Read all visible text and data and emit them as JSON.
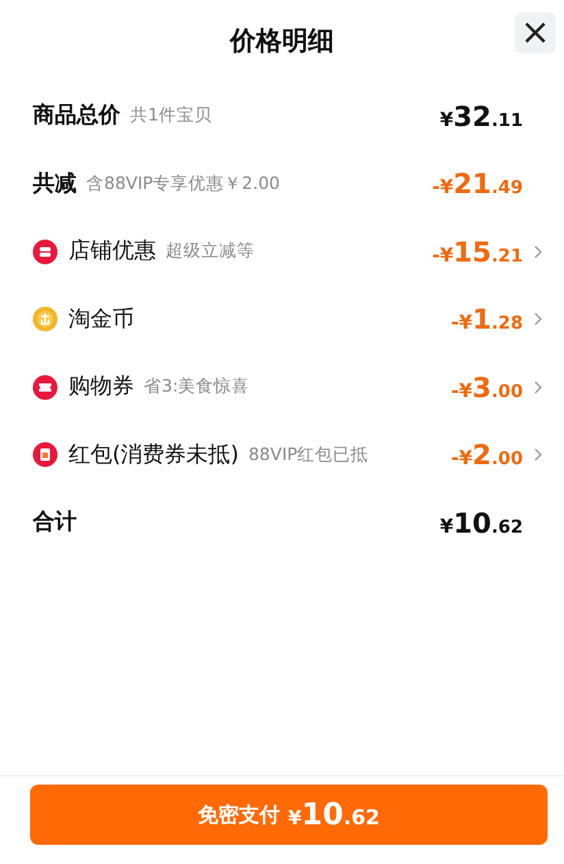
{
  "header": {
    "title": "价格明细",
    "close_label": "×"
  },
  "rows": [
    {
      "kind": "total",
      "label": "商品总价",
      "note": "共1件宝贝",
      "amount": {
        "prefix": "¥",
        "integer": "32",
        "fraction": ".11"
      },
      "expandable": false
    },
    {
      "kind": "discount",
      "label": "共减",
      "note": "含88VIP专享优惠￥2.00",
      "amount": {
        "prefix": "-¥",
        "integer": "21",
        "fraction": ".49"
      },
      "expandable": false
    },
    {
      "kind": "shop",
      "label": "店铺优惠",
      "note": "超级立减等",
      "amount": {
        "prefix": "-¥",
        "integer": "15",
        "fraction": ".21"
      },
      "expandable": true
    },
    {
      "kind": "coin",
      "label": "淘金币",
      "amount": {
        "prefix": "-¥",
        "integer": "1",
        "fraction": ".28"
      },
      "expandable": true
    },
    {
      "kind": "coupon",
      "label": "购物券",
      "note": "省3:美食惊喜",
      "amount": {
        "prefix": "-¥",
        "integer": "3",
        "fraction": ".00"
      },
      "expandable": true
    },
    {
      "kind": "envelope",
      "label": "红包(消费券未抵)",
      "note": "88VIP红包已抵",
      "amount": {
        "prefix": "-¥",
        "integer": "2",
        "fraction": ".00"
      },
      "expandable": true
    },
    {
      "kind": "total",
      "label": "合计",
      "amount": {
        "prefix": "¥",
        "integer": "10",
        "fraction": ".62"
      },
      "expandable": false
    }
  ],
  "pay_button": {
    "label": "免密支付",
    "amount": {
      "prefix": "¥",
      "integer": "10",
      "fraction": ".62"
    }
  }
}
